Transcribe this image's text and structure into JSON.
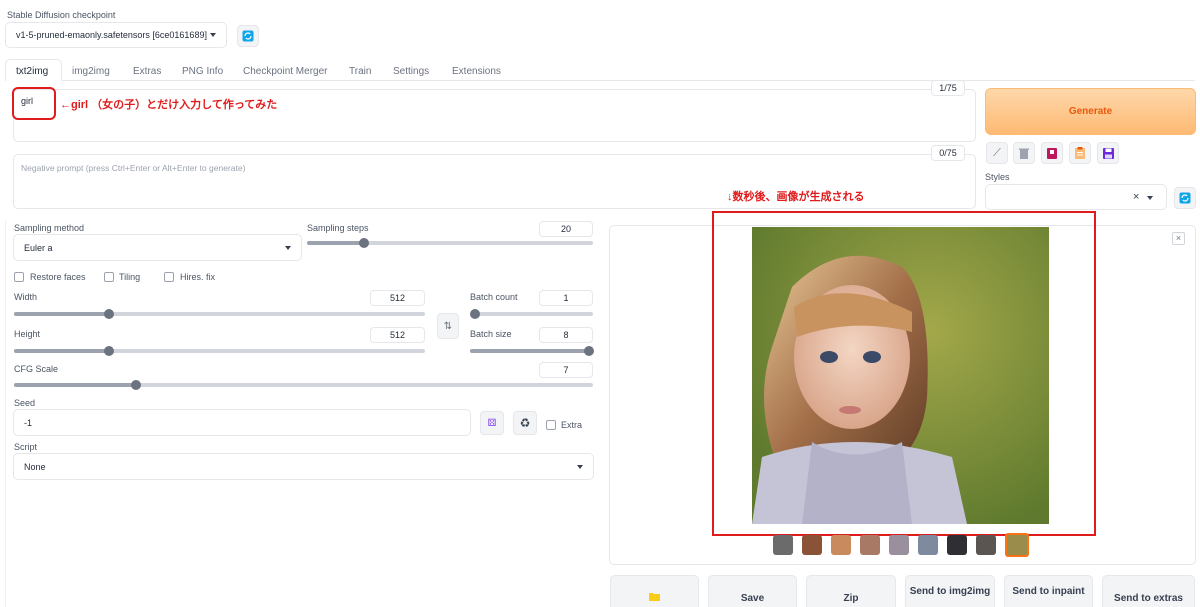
{
  "checkpoint": {
    "label": "Stable Diffusion checkpoint",
    "value": "v1-5-pruned-emaonly.safetensors [6ce0161689]"
  },
  "tabs": [
    "txt2img",
    "img2img",
    "Extras",
    "PNG Info",
    "Checkpoint Merger",
    "Train",
    "Settings",
    "Extensions"
  ],
  "prompt": {
    "value": "girl",
    "token_count": "1/75"
  },
  "negative_prompt": {
    "placeholder": "Negative prompt (press Ctrl+Enter or Alt+Enter to generate)",
    "token_count": "0/75"
  },
  "generate_label": "Generate",
  "styles_label": "Styles",
  "clear_glyph": "×",
  "sampling": {
    "method_label": "Sampling method",
    "method_value": "Euler a",
    "steps_label": "Sampling steps",
    "steps_value": "20",
    "steps_fraction": 0.2
  },
  "checkboxes": {
    "restore_faces": "Restore faces",
    "tiling": "Tiling",
    "hires_fix": "Hires. fix"
  },
  "width": {
    "label": "Width",
    "value": "512",
    "fraction": 0.23
  },
  "height": {
    "label": "Height",
    "value": "512",
    "fraction": 0.23
  },
  "batch_count": {
    "label": "Batch count",
    "value": "1",
    "fraction": 0.0
  },
  "batch_size": {
    "label": "Batch size",
    "value": "8",
    "fraction": 1.0
  },
  "cfg_scale": {
    "label": "CFG Scale",
    "value": "7",
    "fraction": 0.21
  },
  "seed": {
    "label": "Seed",
    "value": "-1",
    "extra_label": "Extra"
  },
  "script": {
    "label": "Script",
    "value": "None"
  },
  "output_buttons": {
    "save": "Save",
    "zip": "Zip",
    "send_img2img": "Send to img2img",
    "send_inpaint": "Send to inpaint",
    "send_extras": "Send to extras"
  },
  "annotations": {
    "prompt_note": "←girl （女の子）とだけ入力して作ってみた",
    "result_note": "↓数秒後、画像が生成される"
  },
  "colors": {
    "generate_bg": "#fdbf82",
    "generate_text": "#ea580c",
    "annotation_red": "#e01b1b",
    "refresh_blue": "#0ea5e9"
  }
}
